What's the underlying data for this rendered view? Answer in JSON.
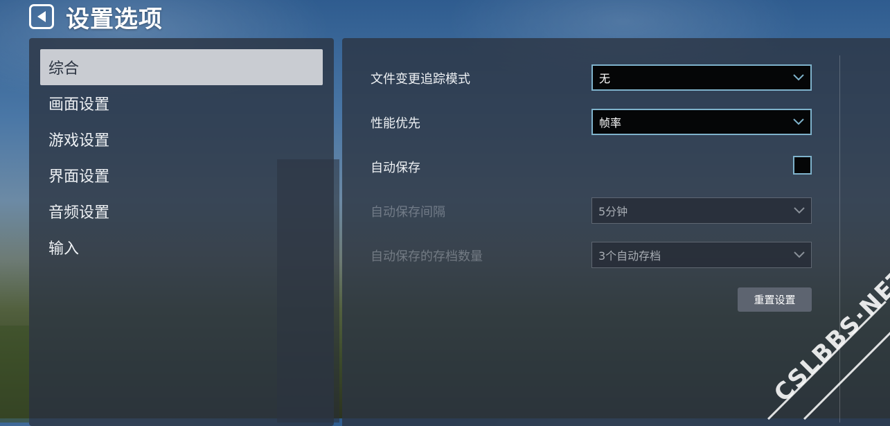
{
  "header": {
    "back_icon": "back-arrow-icon",
    "title": "设置选项"
  },
  "nav": {
    "items": [
      {
        "label": "综合",
        "active": true
      },
      {
        "label": "画面设置"
      },
      {
        "label": "游戏设置"
      },
      {
        "label": "界面设置"
      },
      {
        "label": "音频设置"
      },
      {
        "label": "输入"
      }
    ]
  },
  "general": {
    "file_tracking": {
      "label": "文件变更追踪模式",
      "value": "无"
    },
    "performance": {
      "label": "性能优先",
      "value": "帧率"
    },
    "autosave": {
      "label": "自动保存",
      "checked": false
    },
    "autosave_interval": {
      "label": "自动保存间隔",
      "value": "5分钟",
      "disabled": true
    },
    "autosave_count": {
      "label": "自动保存的存档数量",
      "value": "3个自动存档",
      "disabled": true
    },
    "reset_label": "重置设置"
  },
  "watermark": "CSLBBS·NET",
  "colors": {
    "accent_border": "#7fb3cc",
    "panel_bg": "#2c3442",
    "active_item_bg": "#c9ccd2"
  }
}
